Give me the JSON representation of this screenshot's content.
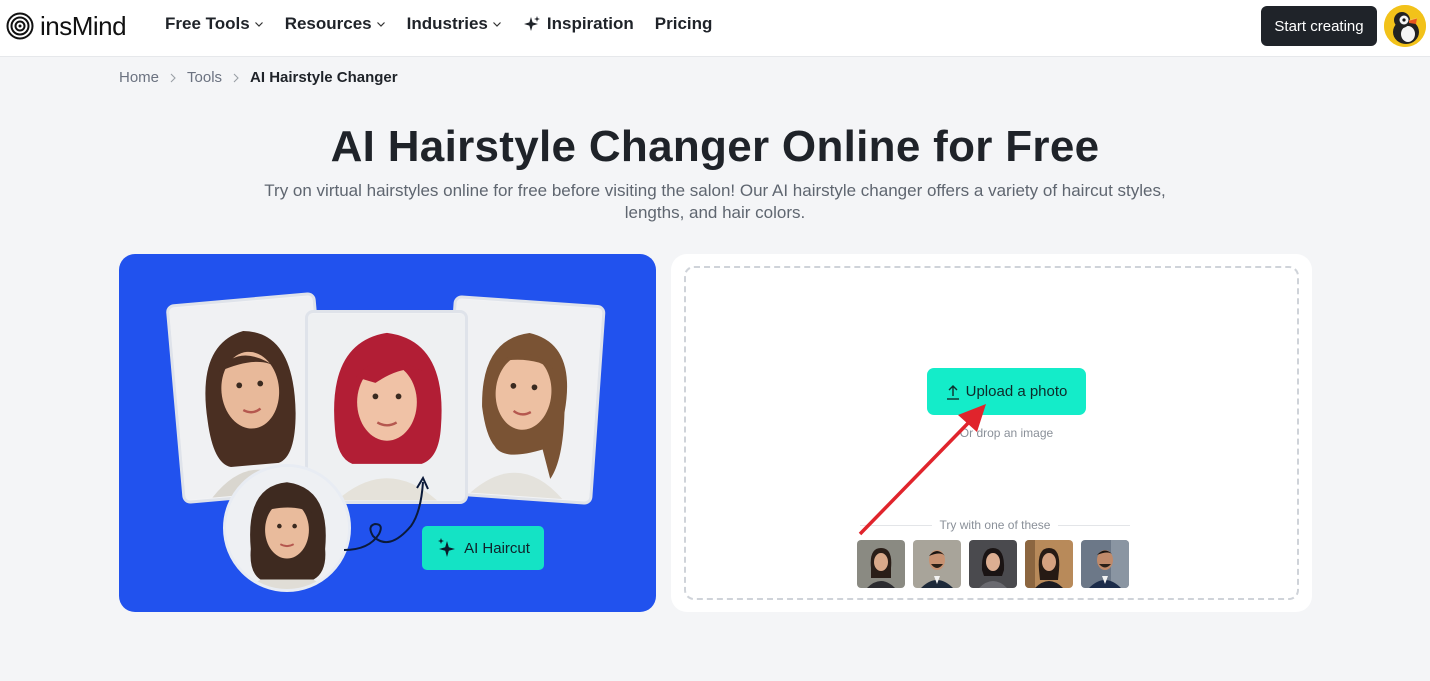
{
  "brand": {
    "name": "insMind",
    "logo_icon": "spiral-logo-icon"
  },
  "nav": {
    "items": [
      {
        "label": "Free Tools",
        "has_dropdown": true
      },
      {
        "label": "Resources",
        "has_dropdown": true
      },
      {
        "label": "Industries",
        "has_dropdown": true
      },
      {
        "label": "Inspiration",
        "has_dropdown": false,
        "icon": "sparkle-icon"
      },
      {
        "label": "Pricing",
        "has_dropdown": false
      }
    ],
    "cta_label": "Start creating"
  },
  "breadcrumb": {
    "items": [
      "Home",
      "Tools"
    ],
    "current": "AI Hairstyle Changer"
  },
  "hero": {
    "title": "AI Hairstyle Changer Online for Free",
    "subtitle": "Try on virtual hairstyles online for free before visiting the salon! Our AI hairstyle changer offers a variety of haircut styles, lengths, and hair colors."
  },
  "promo": {
    "badge_label": "AI Haircut",
    "accent_color": "#2152ee",
    "badge_color": "#14e3c5"
  },
  "upload": {
    "button_label": "Upload a photo",
    "drop_hint": "Or drop an image",
    "samples_label": "Try with one of these",
    "button_color": "#14ecc9",
    "samples": [
      "sample-woman-1",
      "sample-man-1",
      "sample-woman-2",
      "sample-woman-3",
      "sample-man-2"
    ]
  },
  "annotation": {
    "arrow_color": "#e0242c"
  }
}
